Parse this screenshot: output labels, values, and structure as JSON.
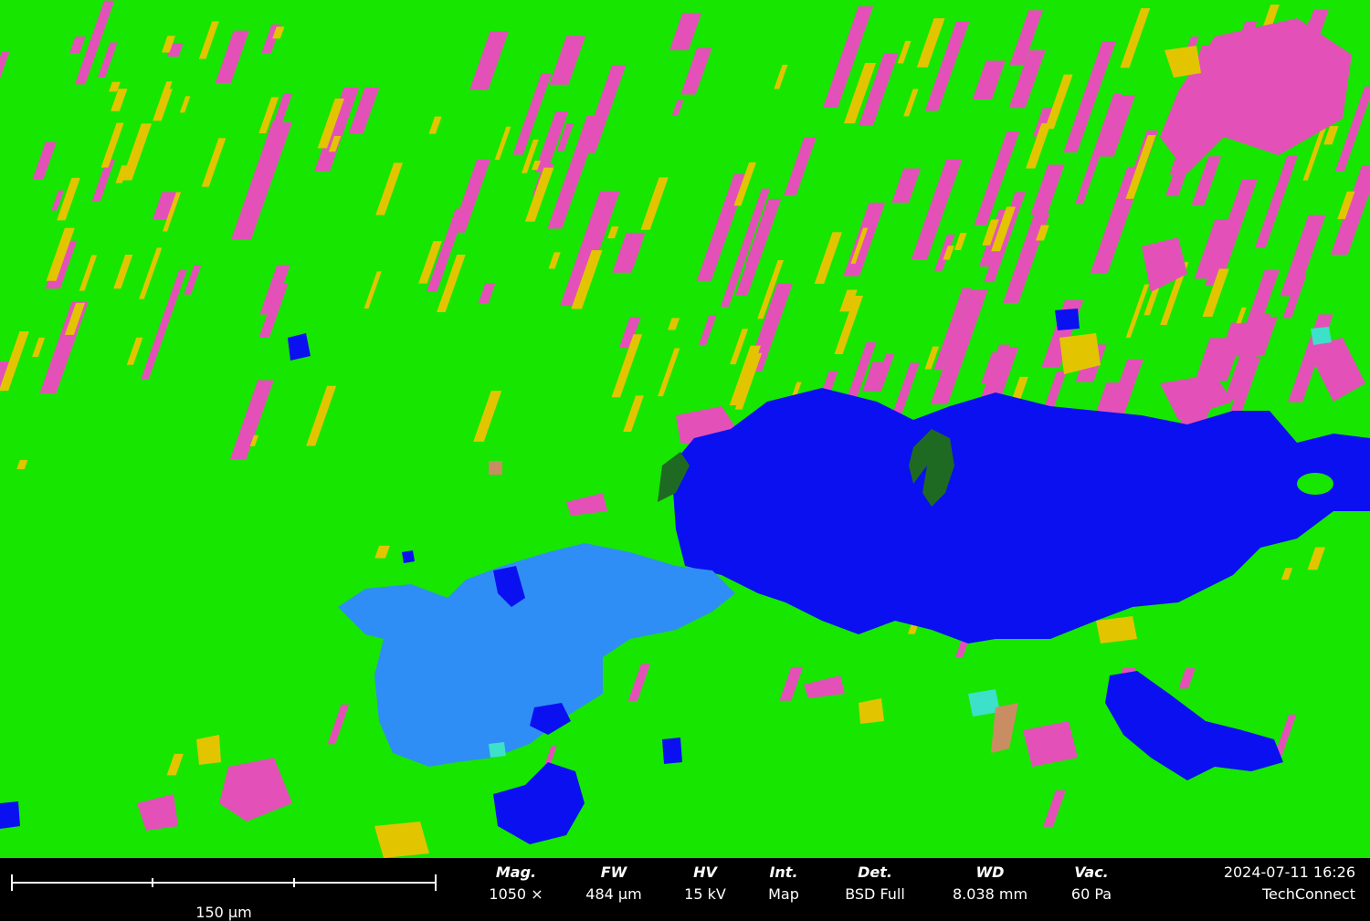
{
  "image": {
    "description": "EDS/BSD phase map of a micrograph",
    "colors": {
      "matrix": "#16e600",
      "pink_phase": "#e351b8",
      "yellow_phase": "#e2c500",
      "blue_phase": "#0a10f0",
      "light_blue_phase": "#2f8ef5",
      "dark_green_phase": "#1f6a22",
      "cyan_phase": "#3de0c8",
      "salmon_phase": "#c98d63"
    }
  },
  "scalebar": {
    "label": "150 µm"
  },
  "fields": [
    {
      "key": "mag",
      "label": "Mag.",
      "value": "1050 ×"
    },
    {
      "key": "fw",
      "label": "FW",
      "value": "484 µm"
    },
    {
      "key": "hv",
      "label": "HV",
      "value": "15 kV"
    },
    {
      "key": "int",
      "label": "Int.",
      "value": "Map"
    },
    {
      "key": "det",
      "label": "Det.",
      "value": "BSD Full"
    },
    {
      "key": "wd",
      "label": "WD",
      "value": "8.038 mm"
    },
    {
      "key": "vac",
      "label": "Vac.",
      "value": "60 Pa"
    }
  ],
  "stamp": {
    "datetime": "2024-07-11 16:26",
    "brand": "TechConnect"
  }
}
